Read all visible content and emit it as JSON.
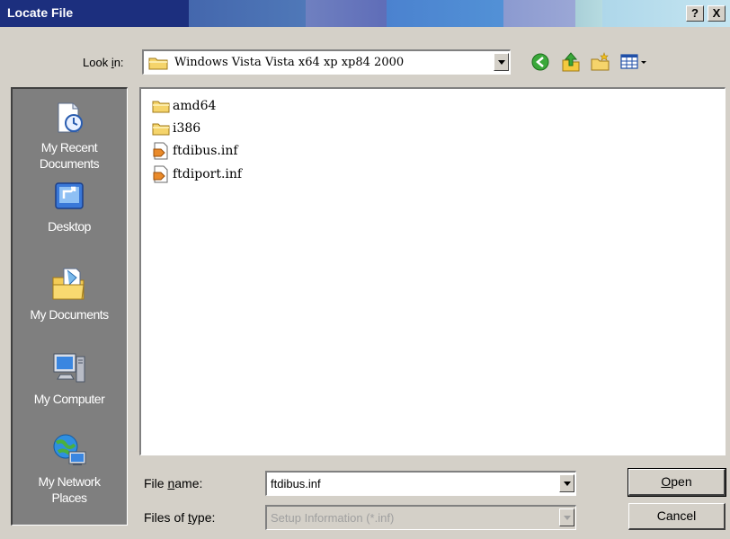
{
  "window": {
    "title": "Locate File",
    "help_label": "?",
    "close_label": "X"
  },
  "lookin": {
    "label_pre": "Look ",
    "label_mnemonic": "i",
    "label_post": "n:",
    "value": "Windows Vista Vista x64 xp xp84 2000"
  },
  "toolbar": {
    "icons": [
      "back-icon",
      "up-folder-icon",
      "new-folder-icon",
      "view-menu-icon"
    ]
  },
  "places": [
    {
      "line1": "My Recent",
      "line2": "Documents",
      "icon": "recent-documents-icon"
    },
    {
      "line1": "Desktop",
      "line2": "",
      "icon": "desktop-icon"
    },
    {
      "line1": "My Documents",
      "line2": "",
      "icon": "my-documents-icon"
    },
    {
      "line1": "My Computer",
      "line2": "",
      "icon": "my-computer-icon"
    },
    {
      "line1": "My Network",
      "line2": "Places",
      "icon": "network-places-icon"
    }
  ],
  "files": [
    {
      "name": "amd64",
      "type": "folder"
    },
    {
      "name": "i386",
      "type": "folder"
    },
    {
      "name": "ftdibus.inf",
      "type": "inf"
    },
    {
      "name": "ftdiport.inf",
      "type": "inf"
    }
  ],
  "filename": {
    "label_pre": "File ",
    "label_mnemonic": "n",
    "label_post": "ame:",
    "value": "ftdibus.inf"
  },
  "filetype": {
    "label_pre": "Files of ",
    "label_mnemonic": "t",
    "label_post": "ype:",
    "value": "Setup Information (*.inf)"
  },
  "buttons": {
    "open_mnemonic": "O",
    "open_rest": "pen",
    "cancel": "Cancel"
  },
  "colors": {
    "dialog_bg": "#d4d0c8",
    "places_bg": "#7f7f7f",
    "title_dark": "#1c2f7e"
  }
}
